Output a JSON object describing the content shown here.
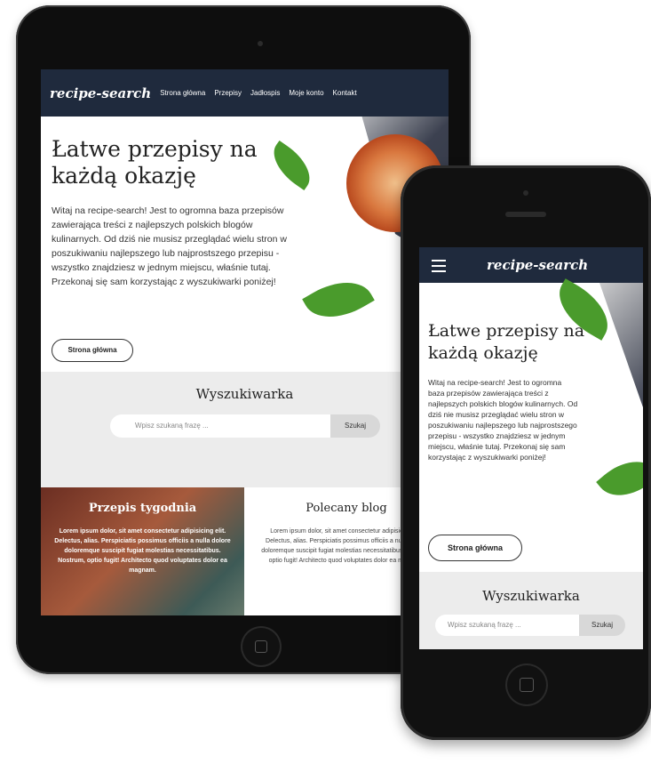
{
  "brand": "recipe-search",
  "nav": [
    "Strona główna",
    "Przepisy",
    "Jadłospis",
    "Moje konto",
    "Kontakt"
  ],
  "hero": {
    "title": "Łatwe przepisy na każdą okazję",
    "text": "Witaj na recipe-search! Jest to ogromna baza przepisów zawierająca treści z najlepszych polskich blogów kulinarnych. Od dziś nie musisz przeglądać wielu stron w poszukiwaniu najlepszego lub najprostszego przepisu - wszystko znajdziesz w jednym miejscu, właśnie tutaj. Przekonaj się sam korzystając z wyszukiwarki poniżej!",
    "button": "Strona główna"
  },
  "search": {
    "title": "Wyszukiwarka",
    "placeholder": "Wpisz szukaną frazę ...",
    "button": "Szukaj"
  },
  "cards": {
    "recipe_title": "Przepis tygodnia",
    "recipe_text": "Lorem ipsum dolor, sit amet consectetur adipisicing elit. Delectus, alias. Perspiciatis possimus officiis a nulla dolore doloremque suscipit fugiat molestias necessitatibus. Nostrum, optio fugit! Architecto quod voluptates dolor ea magnam.",
    "blog_title": "Polecany blog",
    "blog_text": "Lorem ipsum dolor, sit amet consectetur adipisicing elit. Delectus, alias. Perspiciatis possimus officiis a nulla dolore doloremque suscipit fugiat molestias necessitatibus. Nostrum, optio fugit! Architecto quod voluptates dolor ea magnam."
  },
  "colors": {
    "nav": "#1f2a3d",
    "search_bg": "#ececec"
  }
}
